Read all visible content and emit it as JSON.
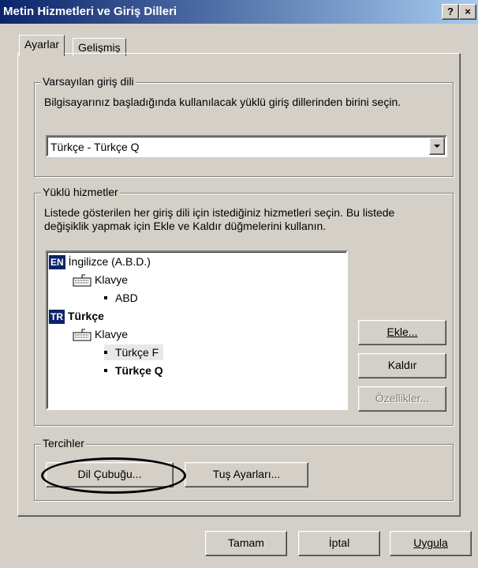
{
  "window": {
    "title": "Metin Hizmetleri ve Giriş Dilleri",
    "help_btn": "?",
    "close_btn": "×"
  },
  "tabs": [
    {
      "label": "Ayarlar",
      "active": true
    },
    {
      "label": "Gelişmiş",
      "active": false
    }
  ],
  "default_language": {
    "legend": "Varsayılan giriş dili",
    "description": "Bilgisayarınız başladığında kullanılacak yüklü giriş dillerinden birini seçin.",
    "selected": "Türkçe - Türkçe Q"
  },
  "installed_services": {
    "legend": "Yüklü hizmetler",
    "description_line1": "Listede gösterilen her giriş dili için istediğiniz hizmetleri seçin. Bu listede",
    "description_line2": "değişiklik yapmak için Ekle ve Kaldır düğmelerini kullanın.",
    "tree": [
      {
        "badge": "EN",
        "label": "İngilizce (A.B.D.)",
        "category": "Klavye",
        "layout": "ABD"
      },
      {
        "badge": "TR",
        "label": "Türkçe",
        "category": "Klavye",
        "layouts": [
          "Türkçe F",
          "Türkçe Q"
        ]
      }
    ],
    "buttons": {
      "add": "Ekle...",
      "remove": "Kaldır",
      "properties": "Özellikler..."
    }
  },
  "preferences": {
    "legend": "Tercihler",
    "language_bar": "Dil Çubuğu...",
    "key_settings": "Tuş Ayarları..."
  },
  "footer": {
    "ok": "Tamam",
    "cancel": "İptal",
    "apply": "Uygula"
  },
  "colors": {
    "title_bar": "#0a246a",
    "face": "#d4d0c8",
    "badge": "#0a246a"
  }
}
